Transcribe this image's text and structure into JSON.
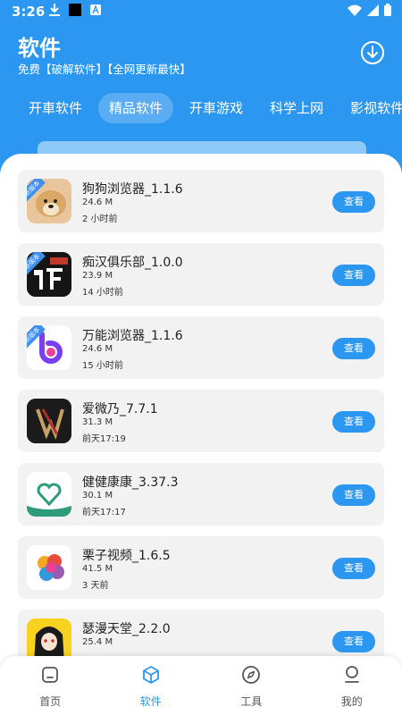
{
  "status_bar": {
    "time": "3:26"
  },
  "header": {
    "title": "软件",
    "subtitle": "免费【破解软件】【全网更新最快】"
  },
  "tabs": [
    {
      "label": "开車软件",
      "active": false
    },
    {
      "label": "精品软件",
      "active": true
    },
    {
      "label": "开車游戏",
      "active": false
    },
    {
      "label": "科学上网",
      "active": false
    },
    {
      "label": "影视软件",
      "active": false
    }
  ],
  "apps": [
    {
      "name": "狗狗浏览器_1.1.6",
      "size": "24.6 M",
      "time": "2 小时前",
      "badge": "新版本",
      "action": "查看",
      "icon": "dog-icon"
    },
    {
      "name": "痴汉俱乐部_1.0.0",
      "size": "23.9 M",
      "time": "14 小时前",
      "badge": "新版本",
      "action": "查看",
      "icon": "chihan-icon"
    },
    {
      "name": "万能浏览器_1.1.6",
      "size": "24.6 M",
      "time": "15 小时前",
      "badge": "新版本",
      "action": "查看",
      "icon": "wanneng-b-icon"
    },
    {
      "name": "爱微乃_7.7.1",
      "size": "31.3 M",
      "time": "前天17:19",
      "action": "查看",
      "icon": "aiweinai-icon"
    },
    {
      "name": "健健康康_3.37.3",
      "size": "30.1 M",
      "time": "前天17:17",
      "action": "查看",
      "icon": "heart-icon"
    },
    {
      "name": "栗子视频_1.6.5",
      "size": "41.5 M",
      "time": "3 天前",
      "action": "查看",
      "icon": "lizi-icon"
    },
    {
      "name": "瑟漫天堂_2.2.0",
      "size": "25.4 M",
      "time": "",
      "action": "查看",
      "icon": "anime-girl-icon"
    }
  ],
  "bottom_nav": [
    {
      "label": "首页",
      "icon": "home-icon",
      "active": false
    },
    {
      "label": "软件",
      "icon": "cube-icon",
      "active": true
    },
    {
      "label": "工具",
      "icon": "compass-icon",
      "active": false
    },
    {
      "label": "我的",
      "icon": "person-icon",
      "active": false
    }
  ],
  "colors": {
    "primary": "#2c97f0",
    "card": "#f2f2f2"
  }
}
